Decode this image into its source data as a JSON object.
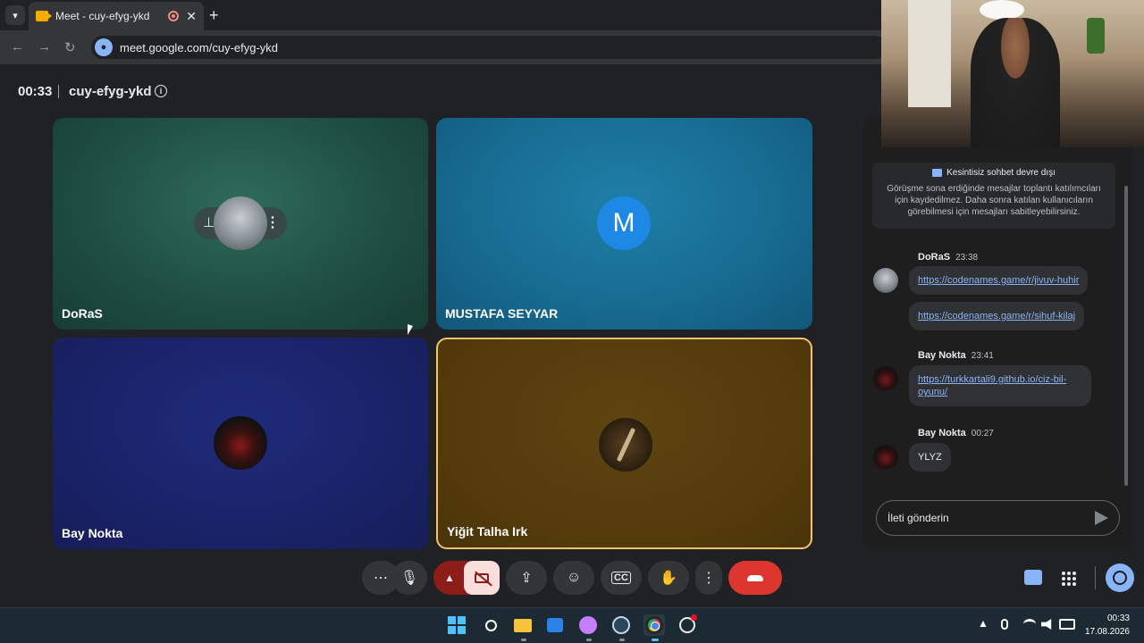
{
  "browser": {
    "tab_title": "Meet - cuy-efyg-ykd",
    "url": "meet.google.com/cuy-efyg-ykd"
  },
  "meeting": {
    "time": "00:33",
    "code": "cuy-efyg-ykd"
  },
  "tiles": [
    {
      "name": "DoRaS",
      "avatar": "photo"
    },
    {
      "name": "MUSTAFA SEYYAR",
      "avatar_letter": "M"
    },
    {
      "name": "Bay Nokta",
      "avatar": "photo"
    },
    {
      "name": "Yiğit Talha Irk",
      "avatar": "logo",
      "active_speaker": true
    }
  ],
  "chat": {
    "notice_title": "Kesintisiz sohbet devre dışı",
    "notice_desc": "Görüşme sona erdiğinde mesajlar toplantı katılımcıları için kaydedilmez. Daha sonra katılan kullanıcıların görebilmesi için mesajları sabitleyebilirsiniz.",
    "messages": [
      {
        "sender": "DoRaS",
        "time": "23:38",
        "texts": [
          "https://codenames.game/r/jivuv-huhir",
          "https://codenames.game/r/sihuf-kilaj"
        ]
      },
      {
        "sender": "Bay Nokta",
        "time": "23:41",
        "texts": [
          "https://turkkartali9.github.io/ciz-bil-oyunu/"
        ]
      },
      {
        "sender": "Bay Nokta",
        "time": "00:27",
        "texts": [
          "YLYZ"
        ]
      }
    ],
    "input_placeholder": "İleti gönderin"
  },
  "controls": {
    "icons": [
      "more-options-icon",
      "mic-icon",
      "chevron-up-icon",
      "camera-off-icon",
      "present-icon",
      "emoji-icon",
      "captions-icon",
      "raise-hand-icon",
      "more-vert-icon",
      "end-call-icon"
    ],
    "leave_color": "#dc362e",
    "camera_off_bg": "#f9dedc"
  },
  "taskbar": {
    "time": "00:33",
    "date": "17.08.2026"
  }
}
